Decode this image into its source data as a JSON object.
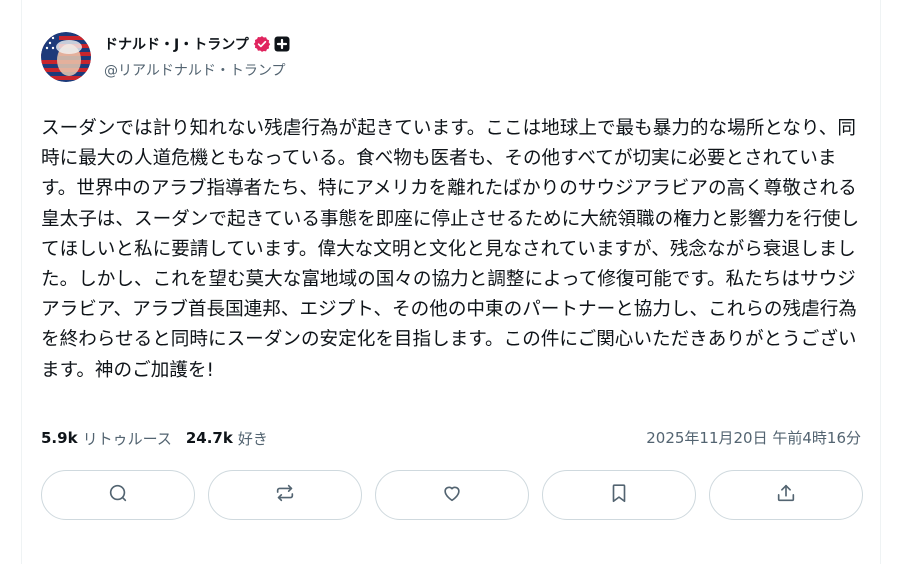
{
  "author": {
    "display_name": "ドナルド・J・トランプ",
    "handle": "@リアルドナルド・トランプ",
    "verified_badge_icon": "verified-badge-icon",
    "subscription_badge_icon": "plus-badge-icon"
  },
  "post": {
    "text": "スーダンでは計り知れない残虐行為が起きています。ここは地球上で最も暴力的な場所となり、同時に最大の人道危機ともなっている。食べ物も医者も、その他すべてが切実に必要とされています。世界中のアラブ指導者たち、特にアメリカを離れたばかりのサウジアラビアの高く尊敬される皇太子は、スーダンで起きている事態を即座に停止させるために大統領職の権力と影響力を行使してほしいと私に要請しています。偉大な文明と文化と見なされていますが、残念ながら衰退しました。しかし、これを望む莫大な富地域の国々の協力と調整によって修復可能です。私たちはサウジアラビア、アラブ首長国連邦、エジプト、その他の中東のパートナーと協力し、これらの残虐行為を終わらせると同時にスーダンの安定化を目指します。この件にご関心いただきありがとうございます。神のご加護を!",
    "timestamp": "2025年11月20日 午前4時16分"
  },
  "stats": {
    "retweets_count": "5.9k",
    "retweets_label": "リトゥルース",
    "likes_count": "24.7k",
    "likes_label": "好き"
  },
  "actions": [
    {
      "icon": "reply-icon"
    },
    {
      "icon": "retruth-icon"
    },
    {
      "icon": "like-icon"
    },
    {
      "icon": "bookmark-icon"
    },
    {
      "icon": "share-icon"
    }
  ],
  "colors": {
    "text_primary": "#0f1419",
    "text_secondary": "#536471",
    "border": "#cfd9de",
    "verified_badge": "#e0245e"
  }
}
